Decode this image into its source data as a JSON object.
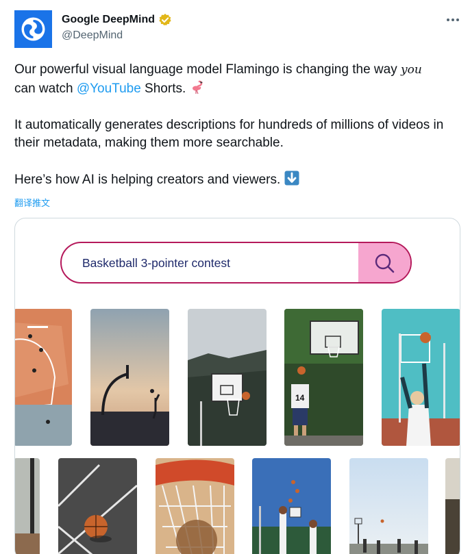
{
  "author": {
    "display_name": "Google DeepMind",
    "handle": "@DeepMind",
    "avatar_icon": "deepmind-logo",
    "verified_icon": "gold-verified-badge-icon"
  },
  "menu": {
    "more_icon": "more-horizontal-icon"
  },
  "tweet": {
    "line1_pre": "Our powerful visual language model Flamingo is changing the way ",
    "line1_emph": "you",
    "line1_cont": " can watch ",
    "mention": "@YouTube",
    "line1_post": " Shorts. ",
    "para2": "It automatically generates descriptions for hundreds of millions of videos in their metadata, making them more searchable.",
    "para3": "Here’s how AI is helping creators and viewers. ",
    "flamingo_emoji": "flamingo-emoji",
    "arrow_emoji": "down-arrow-emoji"
  },
  "translate_label": "翻译推文",
  "media": {
    "search_query": "Basketball 3-pointer contest",
    "search_icon": "magnifier-icon",
    "colors": {
      "border": "#b5195b",
      "button": "#f6a6cf",
      "query_text": "#1f2a6b"
    }
  },
  "colors": {
    "link": "#1d9bf0",
    "secondary": "#536471",
    "text": "#0f1419"
  }
}
